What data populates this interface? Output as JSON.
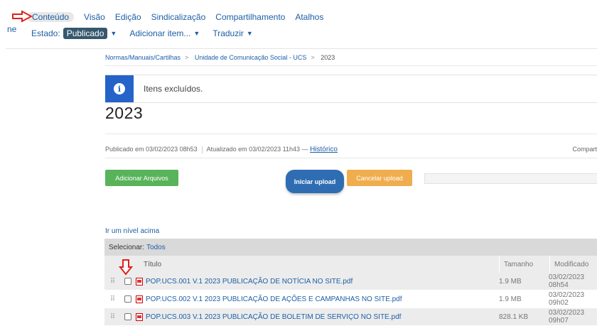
{
  "edit_bar": {
    "tabs": [
      "Conteúdo",
      "Visão",
      "Edição",
      "Sindicalização",
      "Compartilhamento",
      "Atalhos"
    ],
    "state_label": "Estado:",
    "state_value": "Publicado",
    "add_item": "Adicionar item...",
    "translate": "Traduzir",
    "left_fragment": "ne"
  },
  "breadcrumb": [
    "Normas/Manuais/Cartilhas",
    "Unidade de Comunicação Social - UCS",
    "2023"
  ],
  "alert": {
    "message": "Itens excluídos."
  },
  "page_title": "2023",
  "byline": {
    "published": "Publicado em 03/02/2023 08h53",
    "updated": "Atualizado em 03/02/2023 11h43 —",
    "history": "Histórico",
    "share": "Compart"
  },
  "buttons": {
    "add_files": "Adicionar Arquivos",
    "start_upload": "Iniciar upload",
    "cancel_upload": "Cancelar upload"
  },
  "level_up": "Ir um nível acima",
  "table": {
    "select_label": "Selecionar:",
    "select_all": "Todos",
    "headers": {
      "title": "Título",
      "size": "Tamanho",
      "modified": "Modificado"
    },
    "rows": [
      {
        "title": "POP.UCS.001 V.1 2023 PUBLICAÇÃO DE NOTÍCIA NO SITE.pdf",
        "size": "1.9 MB",
        "modified": "03/02/2023 08h54"
      },
      {
        "title": "POP.UCS.002 V.1 2023 PUBLICAÇÃO DE AÇÕES E CAMPANHAS NO SITE.pdf",
        "size": "1.9 MB",
        "modified": "03/02/2023 09h02"
      },
      {
        "title": "POP.UCS.003 V.1 2023 PUBLICAÇÃO DE BOLETIM DE SERVIÇO NO SITE.pdf",
        "size": "828.1 KB",
        "modified": "03/02/2023 09h07"
      }
    ]
  },
  "colors": {
    "link": "#1d5fa5",
    "add_button": "#58b35a",
    "upload_button": "#2e6db2",
    "cancel_button": "#f0ad4e",
    "info": "#2563c9",
    "arrow": "#e0201c"
  }
}
